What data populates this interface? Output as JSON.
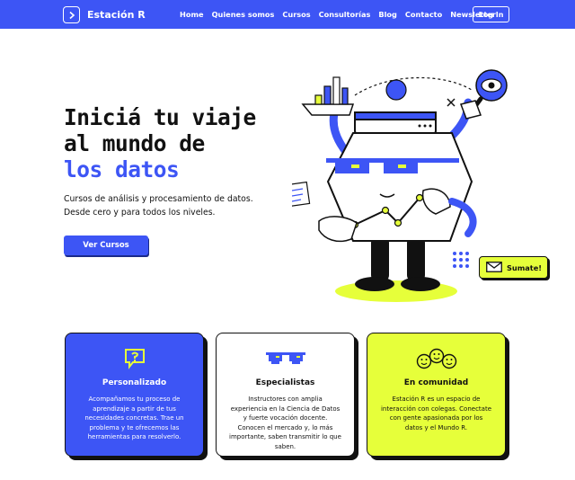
{
  "brand": {
    "name": "Estación R",
    "logo_icon": "chevron-right-icon"
  },
  "nav": {
    "links": [
      "Home",
      "Quienes somos",
      "Cursos",
      "Consultorías",
      "Blog",
      "Contacto",
      "Newsletter"
    ],
    "login_label": "Log In"
  },
  "hero": {
    "title_line1": "Iniciá tu viaje",
    "title_line2": "al mundo de",
    "title_line3": "los datos",
    "subtitle_line1": "Cursos de análisis y procesamiento de datos.",
    "subtitle_line2": "Desde cero y para todos los niveles.",
    "cta_label": "Ver Cursos"
  },
  "sumate": {
    "label": "Sumate!",
    "icon": "envelope-icon"
  },
  "cards": [
    {
      "title": "Personalizado",
      "icon": "speech-bubble-question-icon",
      "text": "Acompañamos tu proceso de aprendizaje a partir de tus necesidades concretas. Trae un problema y te ofrecemos las herramientas para resolverlo."
    },
    {
      "title": "Especialistas",
      "icon": "pixel-sunglasses-icon",
      "text": "Instructores con amplia experiencia en la Ciencia de Datos y fuerte vocación docente. Conocen el mercado y, lo más importante, saben transmitir lo que saben."
    },
    {
      "title": "En comunidad",
      "icon": "smiley-faces-icon",
      "text": "Estación R es un espacio de interacción con colegas. Conectate con gente apasionada por los datos y el Mundo R."
    }
  ],
  "colors": {
    "primary": "#3d55f5",
    "accent": "#e6ff3a",
    "dark": "#111111"
  }
}
